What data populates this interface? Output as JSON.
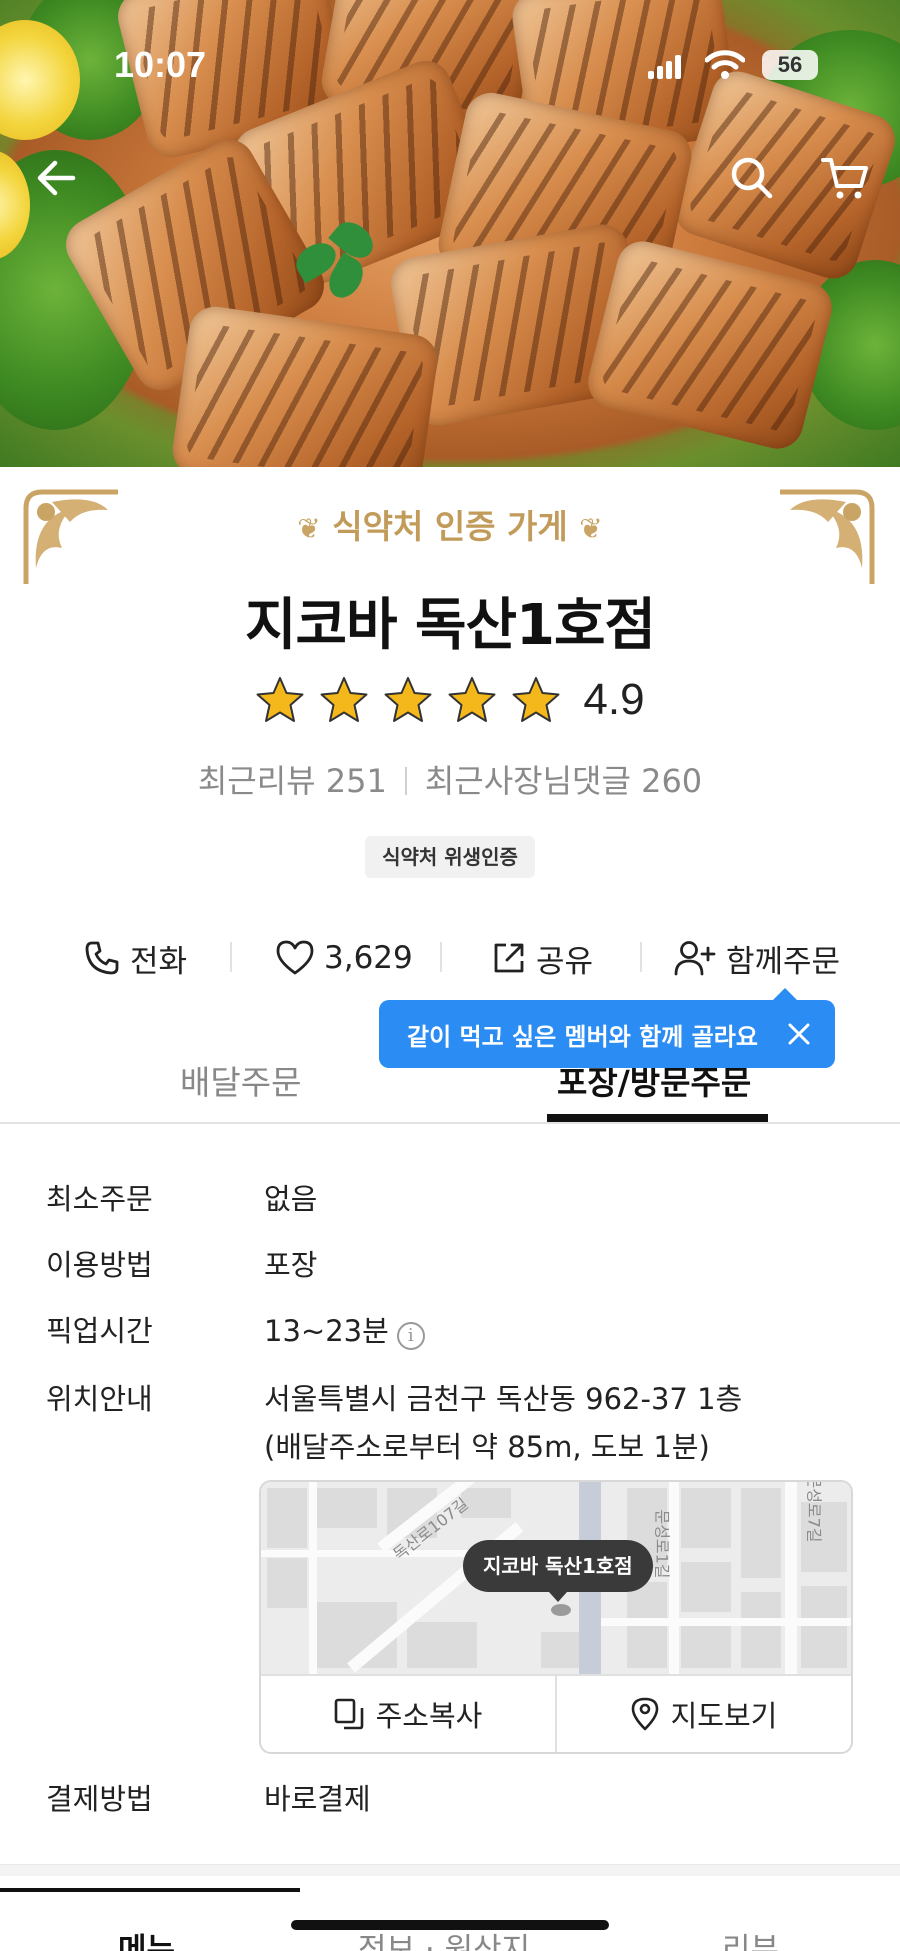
{
  "status_bar": {
    "time": "10:07",
    "battery": "56"
  },
  "hero": {
    "image": "grilled-chicken-platter"
  },
  "header": {
    "certification": "식약처 인증 가게",
    "store_name": "지코바 독산1호점",
    "rating": 4.9,
    "rating_text": "4.9",
    "stars": 5,
    "recent_reviews_label": "최근리뷰 251",
    "owner_replies_label": "최근사장님댓글 260",
    "hygiene_badge": "식약처 위생인증",
    "accent_color": "#c29b5a"
  },
  "actions": {
    "call": "전화",
    "likes": "3,629",
    "share": "공유",
    "group_order": "함께주문"
  },
  "tooltip": {
    "text": "같이 먹고 싶은 멤버와 함께 골라요",
    "color": "#2b8cf3"
  },
  "order_tabs": {
    "delivery": "배달주문",
    "pickup": "포장/방문주문",
    "active": "pickup"
  },
  "info": {
    "min_order_label": "최소주문",
    "min_order_value": "없음",
    "method_label": "이용방법",
    "method_value": "포장",
    "pickup_time_label": "픽업시간",
    "pickup_time_value": "13~23분",
    "location_label": "위치안내",
    "address_line1": "서울특별시 금천구 독산동 962-37 1층",
    "address_line2": "(배달주소로부터 약 85m, 도보 1분)",
    "payment_label": "결제방법",
    "payment_value": "바로결제"
  },
  "map": {
    "pin_label": "지코바 독산1호점",
    "street_1": "독산로107길",
    "street_2": "문성로1길",
    "street_3": "문성로7길",
    "copy_address": "주소복사",
    "view_map": "지도보기"
  },
  "bottom_tabs": {
    "menu": "메뉴",
    "info": "정보 · 원산지",
    "reviews": "리뷰",
    "active": "menu"
  }
}
